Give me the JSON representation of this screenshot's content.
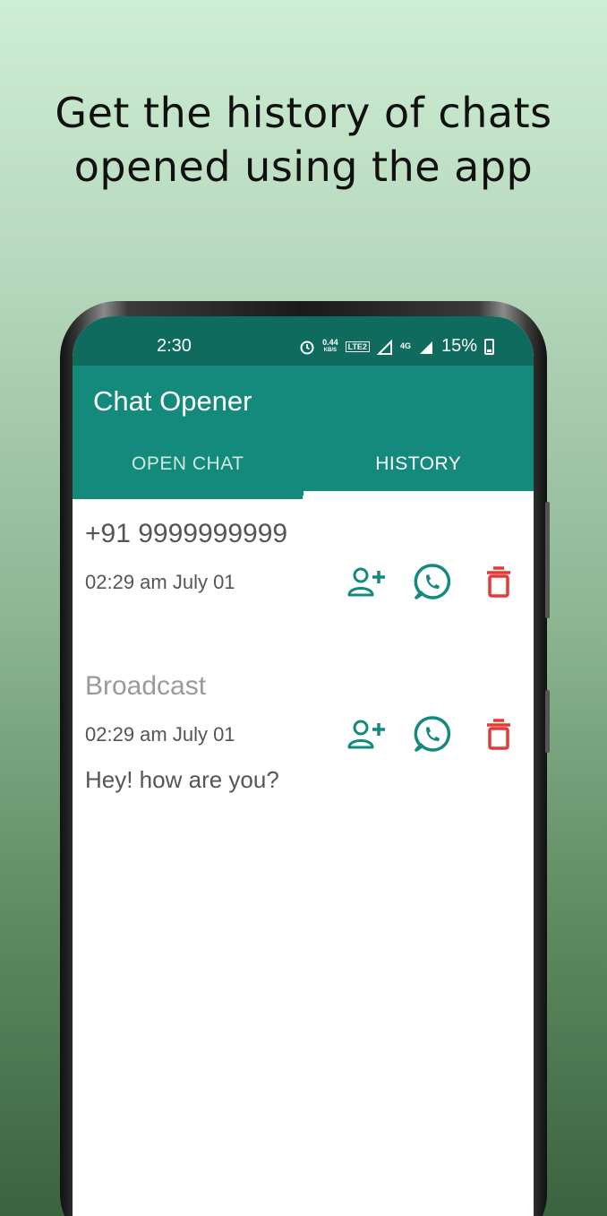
{
  "headline": {
    "line1": "Get the history of chats",
    "line2": "opened using the app"
  },
  "status_bar": {
    "time": "2:30",
    "net_speed": "0.44",
    "net_unit": "KB/S",
    "volte": "LTE2",
    "network": "4G",
    "battery": "15%"
  },
  "app": {
    "title": "Chat Opener",
    "tabs": [
      {
        "label": "OPEN CHAT",
        "active": false
      },
      {
        "label": "HISTORY",
        "active": true
      }
    ]
  },
  "history": [
    {
      "title": "+91 9999999999",
      "time": "02:29 am  July 01",
      "message": ""
    },
    {
      "title": "Broadcast",
      "time": "02:29 am  July 01",
      "message": "Hey! how are you?"
    }
  ],
  "colors": {
    "teal": "#148a7c",
    "teal_dark": "#0e6b5e",
    "delete_red": "#e53935"
  },
  "icons": [
    "add-contact-icon",
    "whatsapp-icon",
    "delete-icon",
    "alarm-icon",
    "signal-icon",
    "battery-icon"
  ]
}
